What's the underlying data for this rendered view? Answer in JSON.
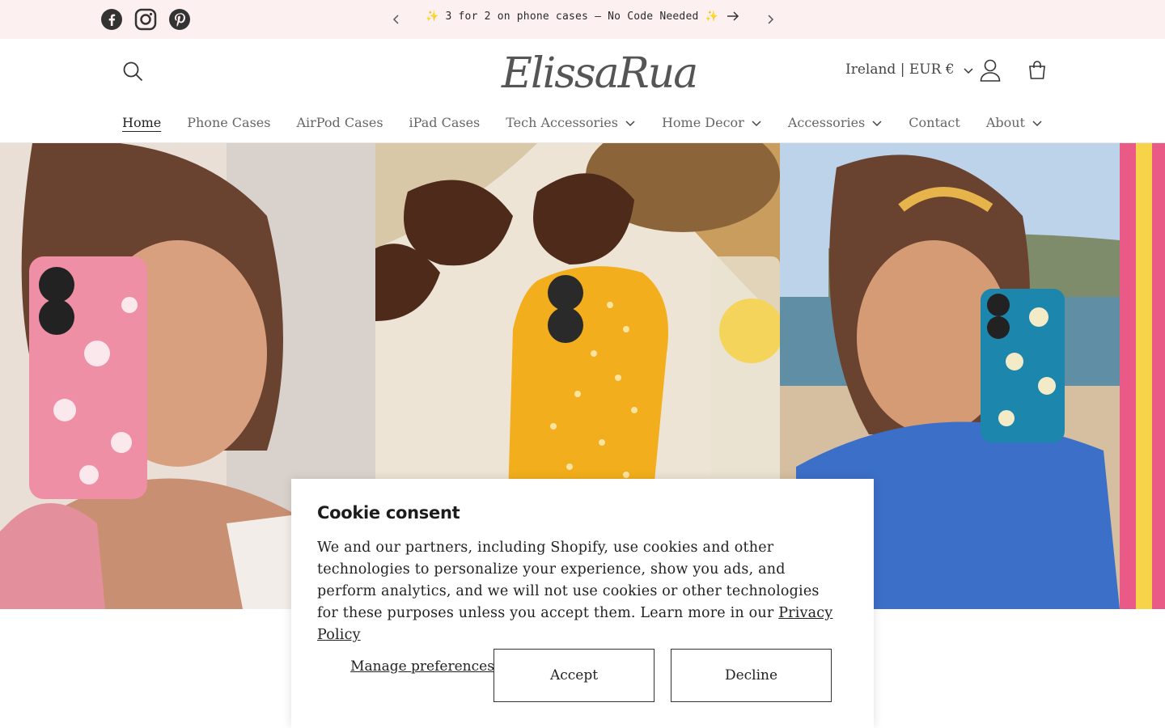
{
  "announcement": {
    "text": "✨ 3 for 2 on phone cases – No Code Needed ✨",
    "social": [
      "facebook-icon",
      "instagram-icon",
      "pinterest-icon"
    ],
    "background": "#fcf0f1"
  },
  "header": {
    "logo": "ElissaRua",
    "locale": "Ireland | EUR €"
  },
  "nav": {
    "items": [
      {
        "label": "Home",
        "active": true,
        "dropdown": false
      },
      {
        "label": "Phone Cases",
        "dropdown": false
      },
      {
        "label": "AirPod Cases",
        "dropdown": false
      },
      {
        "label": "iPad Cases",
        "dropdown": false
      },
      {
        "label": "Tech Accessories",
        "dropdown": true
      },
      {
        "label": "Home Decor",
        "dropdown": true
      },
      {
        "label": "Accessories",
        "dropdown": true
      },
      {
        "label": "Contact",
        "dropdown": false
      },
      {
        "label": "About",
        "dropdown": true
      }
    ]
  },
  "cookie": {
    "title": "Cookie consent",
    "body": "We and our partners, including Shopify, use cookies and other technologies to personalize your experience, show you ads, and perform analytics, and we will not use cookies or other technologies for these purposes unless you accept them. Learn more in our ",
    "privacy_link": "Privacy Policy",
    "manage": "Manage preferences",
    "accept": "Accept",
    "decline": "Decline"
  }
}
